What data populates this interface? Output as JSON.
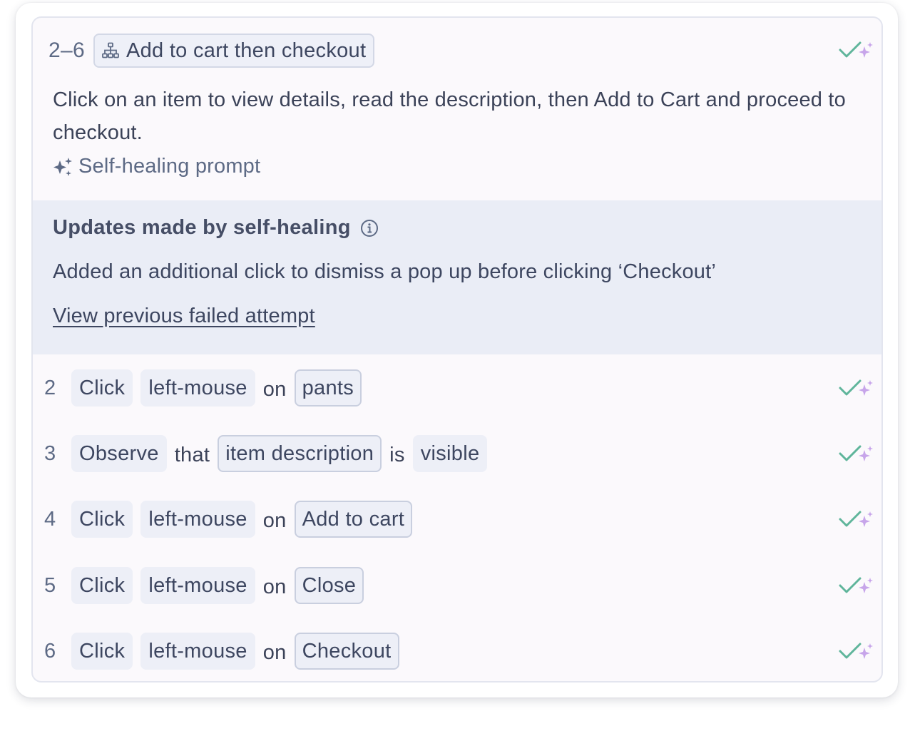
{
  "group": {
    "range": "2–6",
    "title": "Add to cart then checkout",
    "description": "Click on an item to view details, read the description, then Add to Cart and proceed to checkout.",
    "self_healing_link": "Self-healing prompt",
    "status_icon": "check-sparkle-icon"
  },
  "updates": {
    "title": "Updates made by self-healing",
    "info_icon": "info-icon",
    "text": "Added an additional click to dismiss a pop up before clicking ‘Checkout’",
    "link": "View previous failed attempt"
  },
  "steps": [
    {
      "num": "2",
      "action": "Click",
      "modifier": "left-mouse",
      "connector": "on",
      "target": "pants"
    },
    {
      "num": "3",
      "action": "Observe",
      "connector": "that",
      "target": "item description",
      "connector2": "is",
      "state": "visible"
    },
    {
      "num": "4",
      "action": "Click",
      "modifier": "left-mouse",
      "connector": "on",
      "target": "Add to cart"
    },
    {
      "num": "5",
      "action": "Click",
      "modifier": "left-mouse",
      "connector": "on",
      "target": "Close"
    },
    {
      "num": "6",
      "action": "Click",
      "modifier": "left-mouse",
      "connector": "on",
      "target": "Checkout"
    }
  ],
  "colors": {
    "check": "#5fb59b",
    "sparkle": "#c7a5ea",
    "panel": "#eaedf6",
    "token": "#edeff7"
  }
}
